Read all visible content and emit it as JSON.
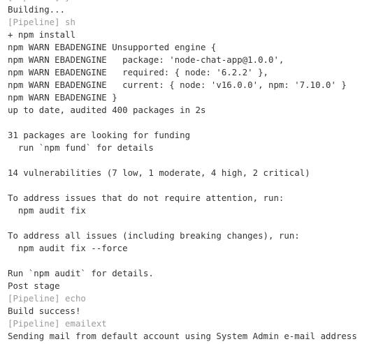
{
  "console": {
    "lines": [
      {
        "text": "[Pipeline] }",
        "kind": "pipeline"
      },
      {
        "text": "Building...",
        "kind": "normal"
      },
      {
        "text": "[Pipeline] sh",
        "kind": "pipeline"
      },
      {
        "text": "+ npm install",
        "kind": "normal"
      },
      {
        "text": "npm WARN EBADENGINE Unsupported engine {",
        "kind": "normal"
      },
      {
        "text": "npm WARN EBADENGINE   package: 'node-chat-app@1.0.0',",
        "kind": "normal"
      },
      {
        "text": "npm WARN EBADENGINE   required: { node: '6.2.2' },",
        "kind": "normal"
      },
      {
        "text": "npm WARN EBADENGINE   current: { node: 'v16.0.0', npm: '7.10.0' }",
        "kind": "normal"
      },
      {
        "text": "npm WARN EBADENGINE }",
        "kind": "normal"
      },
      {
        "text": "up to date, audited 400 packages in 2s",
        "kind": "normal"
      },
      {
        "text": "",
        "kind": "blank"
      },
      {
        "text": "31 packages are looking for funding",
        "kind": "normal"
      },
      {
        "text": "  run `npm fund` for details",
        "kind": "normal"
      },
      {
        "text": "",
        "kind": "blank"
      },
      {
        "text": "14 vulnerabilities (7 low, 1 moderate, 4 high, 2 critical)",
        "kind": "normal"
      },
      {
        "text": "",
        "kind": "blank"
      },
      {
        "text": "To address issues that do not require attention, run:",
        "kind": "normal"
      },
      {
        "text": "  npm audit fix",
        "kind": "normal"
      },
      {
        "text": "",
        "kind": "blank"
      },
      {
        "text": "To address all issues (including breaking changes), run:",
        "kind": "normal"
      },
      {
        "text": "  npm audit fix --force",
        "kind": "normal"
      },
      {
        "text": "",
        "kind": "blank"
      },
      {
        "text": "Run `npm audit` for details.",
        "kind": "normal"
      },
      {
        "text": "Post stage",
        "kind": "normal"
      },
      {
        "text": "[Pipeline] echo",
        "kind": "pipeline"
      },
      {
        "text": "Build success!",
        "kind": "normal"
      },
      {
        "text": "[Pipeline] emailext",
        "kind": "pipeline"
      },
      {
        "text": "Sending mail from default account using System Admin e-mail address",
        "kind": "normal"
      }
    ]
  },
  "colors": {
    "text": "#333333",
    "pipeline": "#9a9a9a",
    "background": "#ffffff"
  }
}
